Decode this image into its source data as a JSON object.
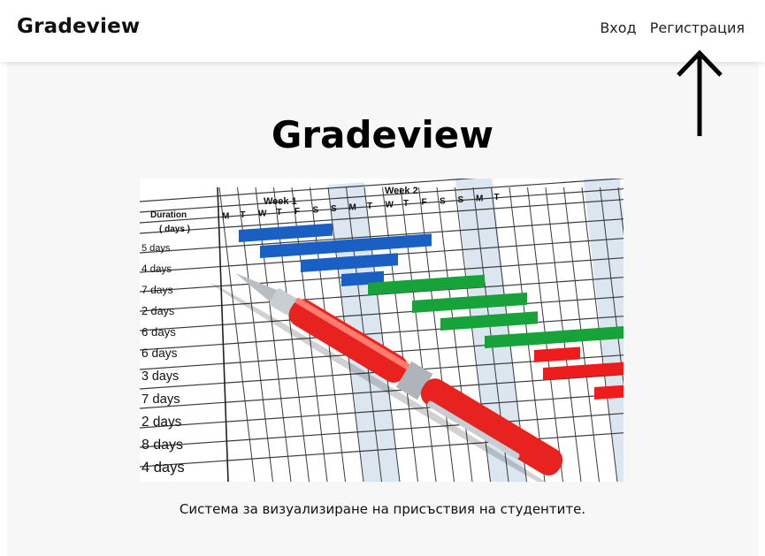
{
  "navbar": {
    "brand": "Gradeview",
    "links": [
      {
        "label": "Вход"
      },
      {
        "label": "Регистрация"
      }
    ]
  },
  "main": {
    "title": "Gradeview",
    "caption": "Система за визуализиране на присъствия на студентите."
  },
  "hero_image": {
    "week_labels": [
      "Week 1",
      "Week 2"
    ],
    "day_letters": [
      "M",
      "T",
      "W",
      "T",
      "F",
      "S",
      "S",
      "M",
      "T",
      "W",
      "T",
      "F",
      "S",
      "S",
      "M",
      "T"
    ],
    "duration_header": [
      "Duration",
      "( days )"
    ],
    "durations": [
      "5 days",
      "4 days",
      "7 days",
      "2 days",
      "6 days",
      "6 days",
      "3 days",
      "7 days",
      "2 days",
      "8 days",
      "4 days"
    ],
    "bar_colors": {
      "blue": "#1a5fc4",
      "green": "#17a23a",
      "red": "#ee1c1c"
    },
    "pen_color": "#e8231f"
  },
  "colors": {
    "background": "#f7f7f7",
    "navbar": "#ffffff",
    "text": "#111111"
  }
}
